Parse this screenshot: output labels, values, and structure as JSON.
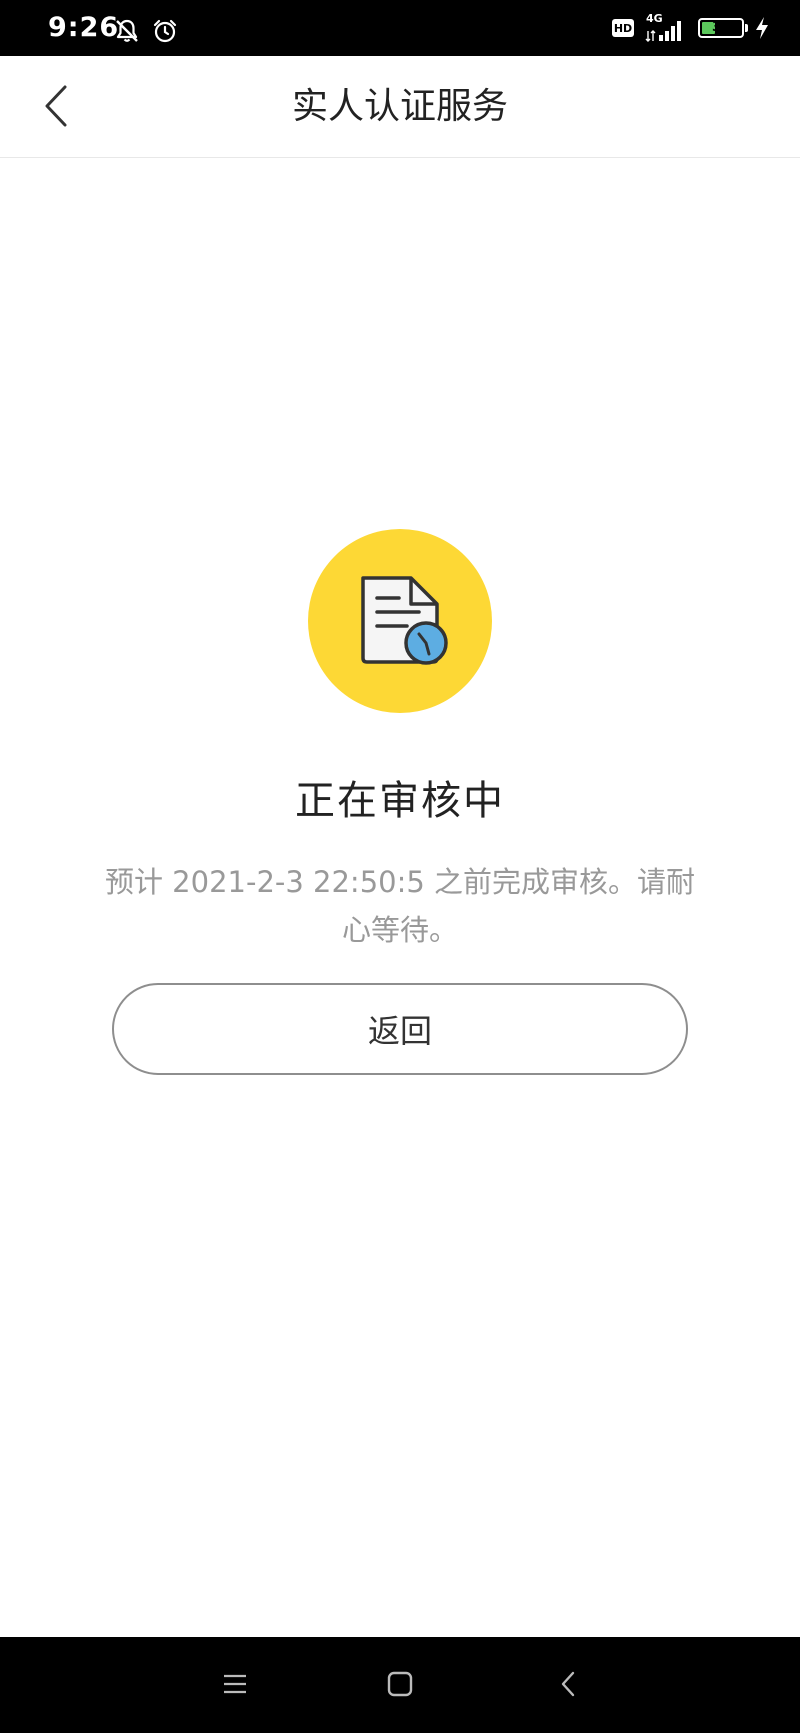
{
  "status_bar": {
    "time": "9:26",
    "hd_label": "HD",
    "network_label": "4G",
    "battery_level": "34",
    "battery_fraction": 0.34
  },
  "header": {
    "title": "实人认证服务",
    "back_icon": "chevron-left-icon"
  },
  "content": {
    "illustration_icon": "document-clock-icon",
    "illustration_color": "#fdd835",
    "clock_color": "#5dade2",
    "heading": "正在审核中",
    "message": "预计 2021-2-3 22:50:5 之前完成审核。请耐心等待。",
    "return_label": "返回"
  },
  "system_nav": {
    "menu_icon": "menu-icon",
    "home_icon": "home-square-icon",
    "back_icon": "back-triangle-icon"
  }
}
